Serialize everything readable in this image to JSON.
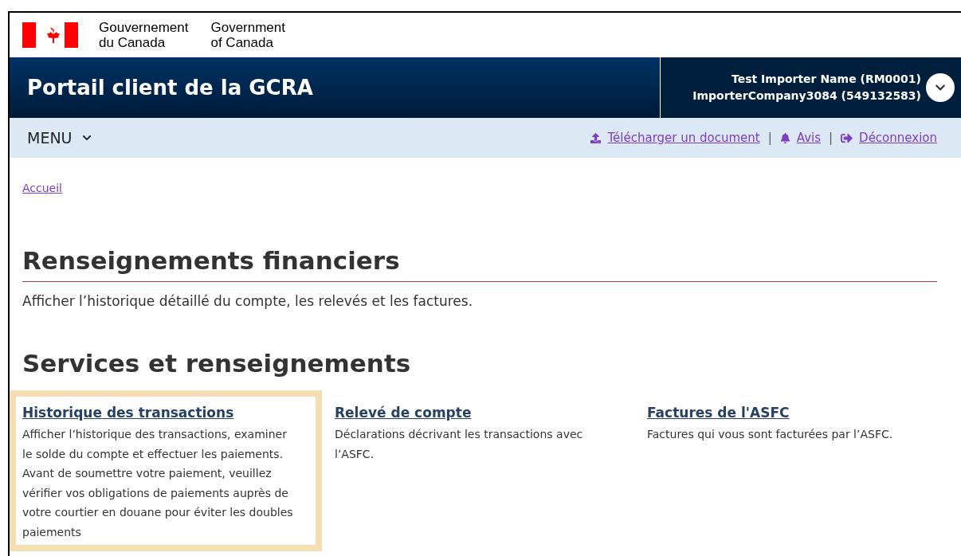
{
  "brand": {
    "fr": [
      "Gouvernement",
      "du Canada"
    ],
    "en": [
      "Government",
      "of Canada"
    ]
  },
  "app_title": "Portail client de la GCRA",
  "account": {
    "lines": [
      "Test Importer Name (RM0001)",
      "ImporterCompany3084 (549132583)"
    ]
  },
  "menu": {
    "label": "MENU"
  },
  "actions": [
    {
      "kind": "upload",
      "label": "Télécharger un document"
    },
    {
      "kind": "bell",
      "label": "Avis"
    },
    {
      "kind": "logout",
      "label": "Déconnexion"
    }
  ],
  "separator": "|",
  "breadcrumb": [
    "Accueil"
  ],
  "heading": "Renseignements financiers",
  "intro": "Afficher l’historique détaillé du compte, les relevés et les factures.",
  "section_heading": "Services et renseignements",
  "services": [
    {
      "title": "Historique des transactions",
      "description": "Afficher l’historique des transactions, examiner le solde du compte et effectuer les paiements. Avant de soumettre votre paiement, veuillez vérifier vos obligations de paiements auprès de votre courtier en douane pour éviter les doubles paiements",
      "highlighted": true
    },
    {
      "title": "Relevé de compte",
      "description": "Déclarations décrivant les transactions avec l’ASFC.",
      "highlighted": false
    },
    {
      "title": "Factures de l'ASFC",
      "description": "Factures qui vous sont facturées par l’ASFC.",
      "highlighted": false
    }
  ]
}
